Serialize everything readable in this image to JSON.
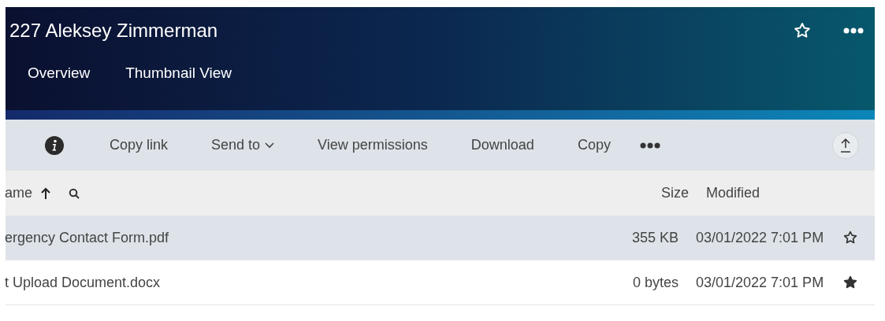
{
  "header": {
    "title": "227 Aleksey Zimmerman",
    "favorite": false
  },
  "tabs": [
    {
      "label": "Overview",
      "selected": false
    },
    {
      "label": "Thumbnail View",
      "selected": false
    }
  ],
  "toolbar": {
    "actions": [
      {
        "label": "Copy link",
        "kind": "plain"
      },
      {
        "label": "Send to",
        "kind": "menu"
      },
      {
        "label": "View permissions",
        "kind": "plain"
      },
      {
        "label": "Download",
        "kind": "plain"
      },
      {
        "label": "Copy",
        "kind": "plain"
      }
    ]
  },
  "table": {
    "columns": [
      {
        "label": "ame"
      },
      {
        "label": "Size"
      },
      {
        "label": "Modified"
      }
    ],
    "rows": [
      {
        "name": "ergency Contact Form.pdf",
        "size": "355 KB",
        "modified": "03/01/2022 7:01 PM",
        "favorite": false,
        "selected": true
      },
      {
        "name": "t Upload Document.docx",
        "size": "0 bytes",
        "modified": "03/01/2022 7:01 PM",
        "favorite": true,
        "selected": false
      }
    ]
  }
}
